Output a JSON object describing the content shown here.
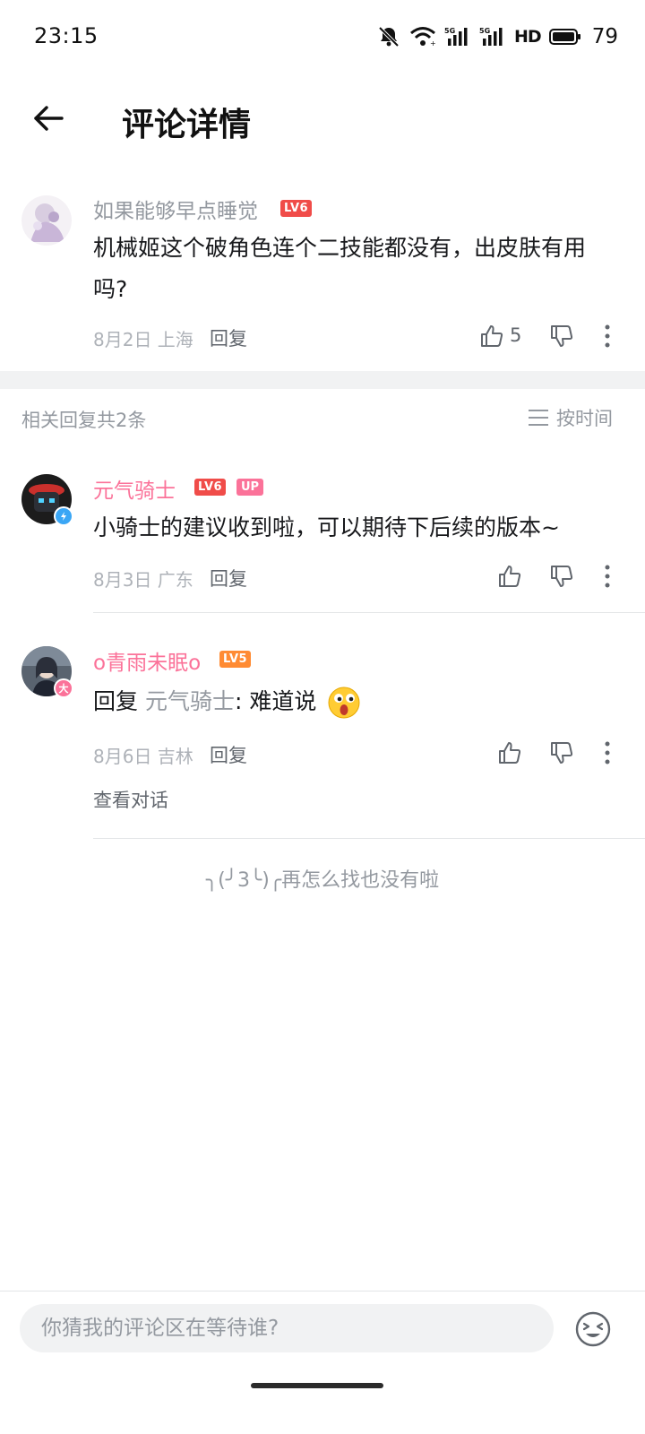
{
  "status_bar": {
    "time": "23:15",
    "net1": "5G",
    "net2": "5G",
    "hd": "HD",
    "battery": "79"
  },
  "header": {
    "title": "评论详情"
  },
  "main_comment": {
    "username": "如果能够早点睡觉",
    "level": "LV6",
    "text": "机械姬这个破角色连个二技能都没有，出皮肤有用吗?",
    "date_loc": "8月2日 上海",
    "reply_label": "回复",
    "likes": "5"
  },
  "replies_header": {
    "count_text": "相关回复共2条",
    "sort_label": "按时间"
  },
  "replies": [
    {
      "username": "元气骑士",
      "level": "LV6",
      "up_badge": "UP",
      "text": "小骑士的建议收到啦，可以期待下后续的版本~",
      "date_loc": "8月3日 广东",
      "reply_label": "回复"
    },
    {
      "username": "o青雨未眠o",
      "level": "LV5",
      "badge": "大",
      "reply_prefix": "回复",
      "mention": "元气骑士",
      "text": ": 难道说",
      "date_loc": "8月6日 吉林",
      "reply_label": "回复",
      "view_conversation": "查看对话"
    }
  ],
  "end_note": "╮(╯3╰)╭再怎么找也没有啦",
  "bottom": {
    "placeholder": "你猜我的评论区在等待谁?"
  },
  "colors": {
    "pink": "#fb7299",
    "lv6": "#f04c49",
    "lv5": "#ff8b33",
    "text_gray": "#9499a0"
  }
}
